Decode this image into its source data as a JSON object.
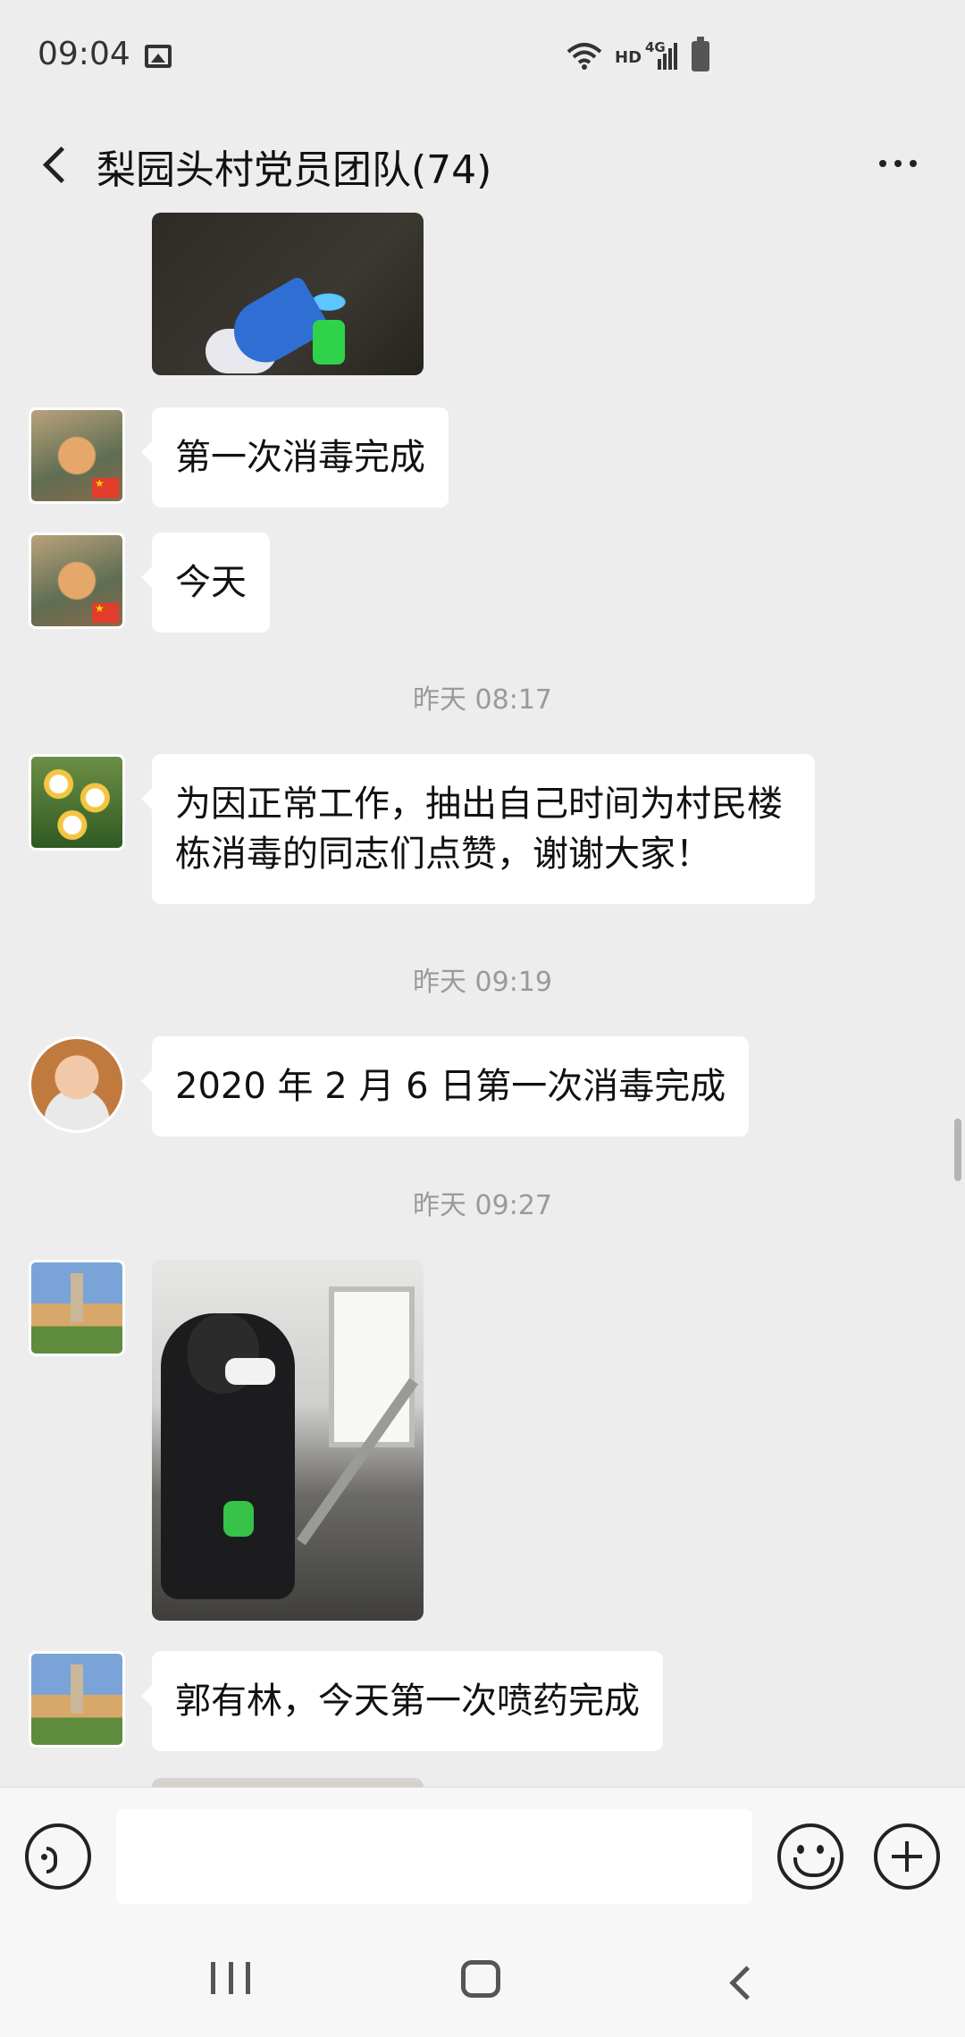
{
  "status_bar": {
    "time": "09:04",
    "network_type": "HD",
    "signal_label": "4G"
  },
  "header": {
    "title": "梨园头村党员团队(74)"
  },
  "messages": {
    "m1": {
      "text": "第一次消毒完成"
    },
    "m2": {
      "text": "今天"
    },
    "ts1": "昨天 08:17",
    "m3": {
      "text": "为因正常工作，抽出自己时间为村民楼栋消毒的同志们点赞，谢谢大家！"
    },
    "ts2": "昨天 09:19",
    "m4": {
      "text": "2020 年 2 月 6 日第一次消毒完成"
    },
    "ts3": "昨天 09:27",
    "m6": {
      "text": "郭有林，今天第一次喷药完成"
    }
  },
  "input": {
    "placeholder": ""
  },
  "icons": {
    "back": "back-arrow-icon",
    "more": "more-icon",
    "voice": "voice-icon",
    "emoji": "emoji-icon",
    "plus": "plus-icon"
  }
}
